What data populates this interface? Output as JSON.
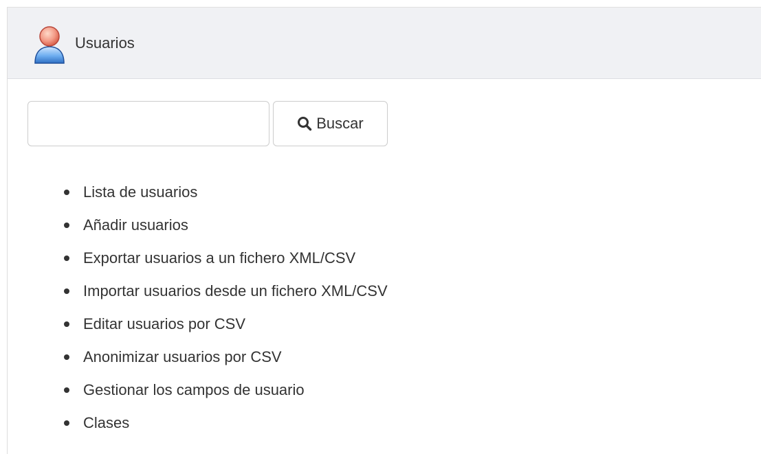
{
  "header": {
    "title": "Usuarios",
    "icon": "user-icon"
  },
  "search": {
    "value": "",
    "placeholder": "",
    "button_label": "Buscar",
    "button_icon": "search-icon"
  },
  "menu": {
    "items": [
      {
        "label": "Lista de usuarios"
      },
      {
        "label": "Añadir usuarios"
      },
      {
        "label": "Exportar usuarios a un fichero XML/CSV"
      },
      {
        "label": "Importar usuarios desde un fichero XML/CSV"
      },
      {
        "label": "Editar usuarios por CSV"
      },
      {
        "label": "Anonimizar usuarios por CSV"
      },
      {
        "label": "Gestionar los campos de usuario"
      },
      {
        "label": "Clases"
      }
    ]
  },
  "colors": {
    "header_bg": "#f0f1f4",
    "text": "#333333",
    "border": "#cccccc"
  }
}
